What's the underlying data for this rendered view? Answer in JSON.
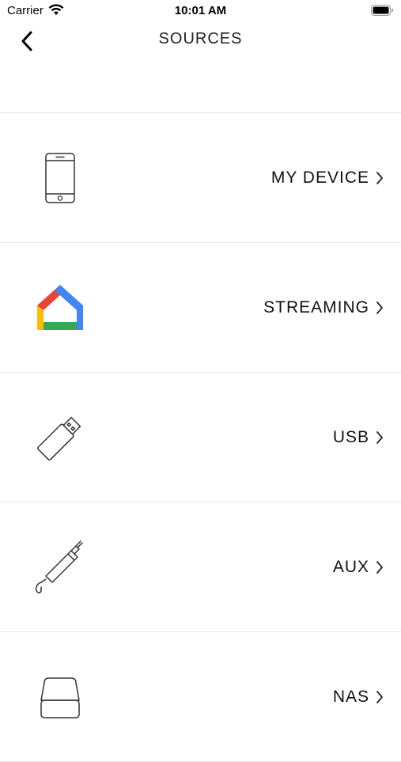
{
  "status_bar": {
    "carrier": "Carrier",
    "time": "10:01 AM"
  },
  "nav": {
    "title": "SOURCES"
  },
  "sources": [
    {
      "label": "MY DEVICE",
      "icon": "phone-icon"
    },
    {
      "label": "STREAMING",
      "icon": "google-home-icon"
    },
    {
      "label": "USB",
      "icon": "usb-drive-icon"
    },
    {
      "label": "AUX",
      "icon": "aux-cable-icon"
    },
    {
      "label": "NAS",
      "icon": "hard-drive-icon"
    }
  ],
  "colors": {
    "google_red": "#EA4335",
    "google_yellow": "#FBBC04",
    "google_green": "#34A853",
    "google_blue": "#4285F4",
    "divider": "#e6e6e6"
  }
}
